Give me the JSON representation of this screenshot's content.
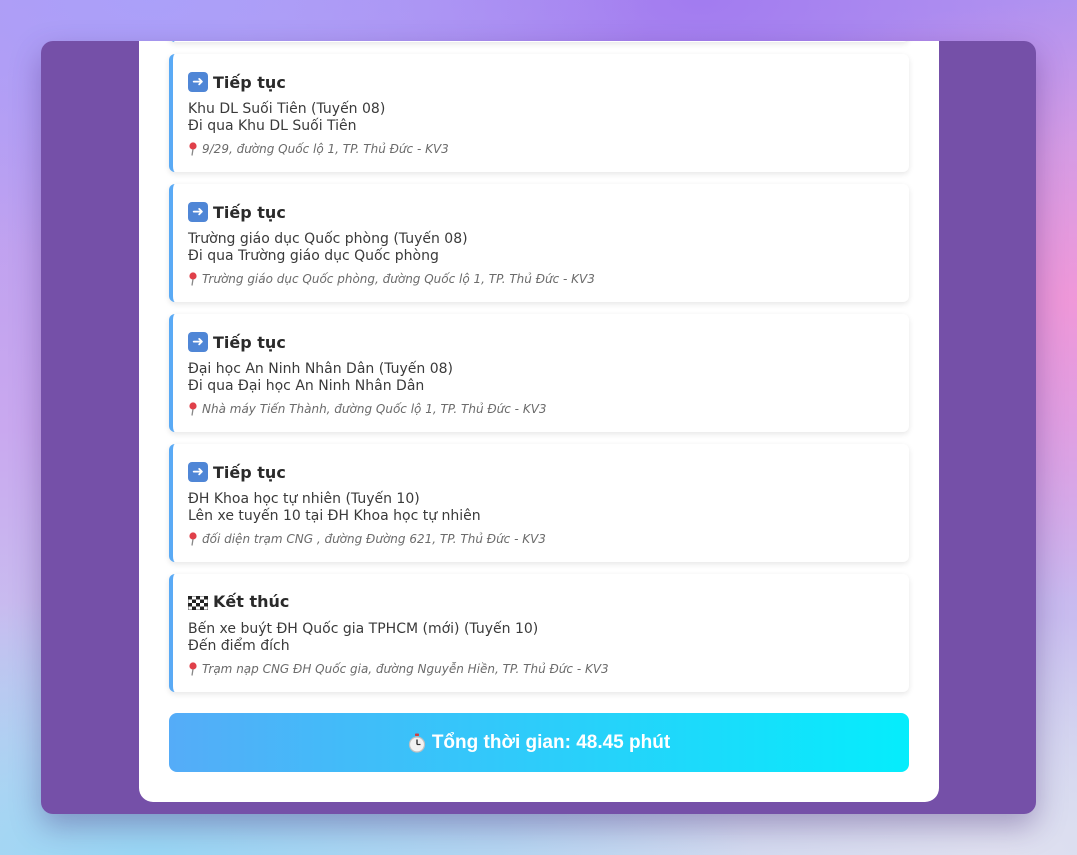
{
  "steps": [
    {
      "kind": "continue",
      "icon": "right-arrow-icon",
      "title": "Tiếp tục",
      "stop": "Khu DL Suối Tiên (Tuyến 08)",
      "action": "Đi qua Khu DL Suối Tiên",
      "address": "9/29, đường Quốc lộ 1, TP. Thủ Đức - KV3"
    },
    {
      "kind": "continue",
      "icon": "right-arrow-icon",
      "title": "Tiếp tục",
      "stop": "Trường giáo dục Quốc phòng (Tuyến 08)",
      "action": "Đi qua Trường giáo dục Quốc phòng",
      "address": "Trường giáo dục Quốc phòng, đường Quốc lộ 1, TP. Thủ Đức - KV3"
    },
    {
      "kind": "continue",
      "icon": "right-arrow-icon",
      "title": "Tiếp tục",
      "stop": "Đại học An Ninh Nhân Dân (Tuyến 08)",
      "action": "Đi qua Đại học An Ninh Nhân Dân",
      "address": "Nhà máy Tiến Thành, đường Quốc lộ 1, TP. Thủ Đức - KV3"
    },
    {
      "kind": "continue",
      "icon": "right-arrow-icon",
      "title": "Tiếp tục",
      "stop": "ĐH Khoa học tự nhiên (Tuyến 10)",
      "action": "Lên xe tuyến 10 tại ĐH Khoa học tự nhiên",
      "address": "đối diện trạm CNG , đường Đường 621, TP. Thủ Đức - KV3"
    },
    {
      "kind": "end",
      "icon": "checkered-flag-icon",
      "title": "Kết thúc",
      "stop": "Bến xe buýt ĐH Quốc gia TPHCM (mới) (Tuyến 10)",
      "action": "Đến điểm đích",
      "address": "Trạm nạp CNG ĐH Quốc gia, đường Nguyễn Hiền, TP. Thủ Đức - KV3"
    }
  ],
  "total": {
    "icon": "stopwatch-icon",
    "text": "Tổng thời gian: 48.45 phút"
  },
  "colors": {
    "accent_border": "#5aaaf5",
    "total_gradient_start": "#55acf8",
    "total_gradient_end": "#05edfc",
    "window_bg": "#7550a8"
  }
}
